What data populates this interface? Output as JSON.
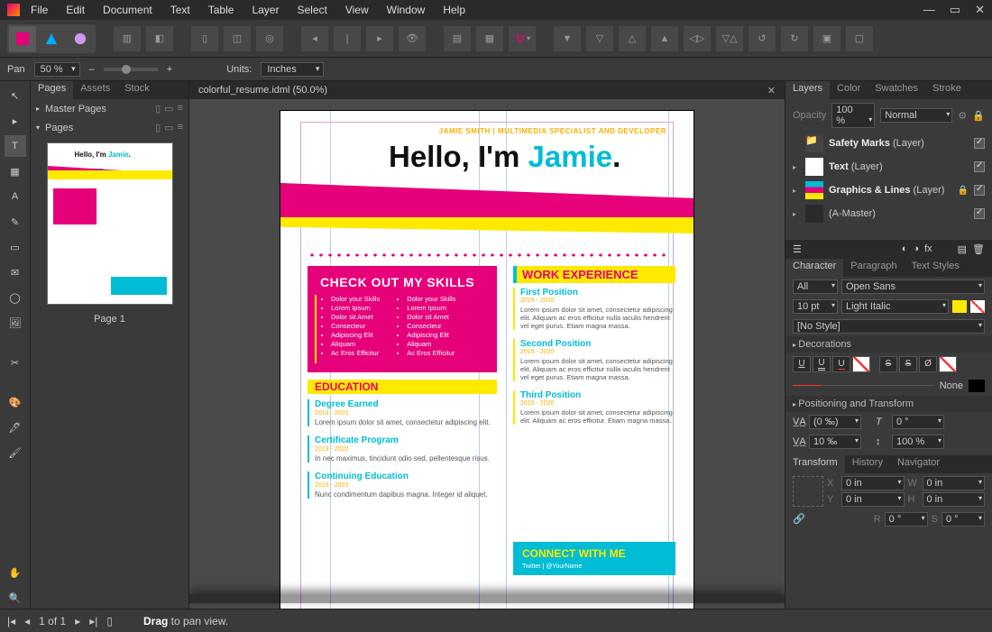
{
  "menu": [
    "File",
    "Edit",
    "Document",
    "Text",
    "Table",
    "Layer",
    "Select",
    "View",
    "Window",
    "Help"
  ],
  "options": {
    "pan_label": "Pan",
    "zoom": "50 %",
    "units_label": "Units:",
    "units": "Inches"
  },
  "pages_panel": {
    "tabs": [
      "Pages",
      "Assets",
      "Stock"
    ],
    "master_label": "Master Pages",
    "pages_label": "Pages",
    "page1_label": "Page 1"
  },
  "doc": {
    "tab_title": "colorful_resume.idml (50.0%)",
    "headline": "JAMIE SMITH | MULTIMEDIA SPECIALIST AND DEVELOPER",
    "hello_pre": "Hello, I'm ",
    "hello_name": "Jamie",
    "hello_dot": ".",
    "skills_title": "CHECK OUT MY SKILLS",
    "skills": [
      "Dolor your Skills",
      "Lorem Ipsum",
      "Dolor sit Amet",
      "Consecteur",
      "Adipiscing Elit",
      "Aliquam",
      "Ac Eros Efficitur"
    ],
    "education_title": "EDUCATION",
    "education": [
      {
        "title": "Degree Earned",
        "dates": "2019 - 2020",
        "body": "Lorem ipsum dolor sit amet, consectetur adipiscing elit."
      },
      {
        "title": "Certificate Program",
        "dates": "2019 - 2020",
        "body": "In nec maximus, tincidunt odio sed, pellentesque risus."
      },
      {
        "title": "Continuing Education",
        "dates": "2019 - 2020",
        "body": "Nunc condimentum dapibus magna. Integer id aliquet."
      }
    ],
    "work_title": "WORK EXPERIENCE",
    "work": [
      {
        "title": "First Position",
        "dates": "2019 - 2020",
        "body": "Lorem ipsum dolor sit amet, consectetur adipiscing elit. Aliquam ac eros efficitur nulla iaculis hendrerit vel eget purus. Etiam magna massa."
      },
      {
        "title": "Second Position",
        "dates": "2019 - 2020",
        "body": "Lorem ipsum dolor sit amet, consectetur adipiscing elit. Aliquam ac eros efficitur nulla iaculis hendrerit vel eget purus. Etiam magna massa."
      },
      {
        "title": "Third Position",
        "dates": "2019 - 2020",
        "body": "Lorem ipsum dolor sit amet, consectetur adipiscing elit. Aliquam ac eros efficitur. Etiam magna massa."
      }
    ],
    "connect_title": "CONNECT WITH ME",
    "connect_body": "Twitter | @YourName"
  },
  "right": {
    "layer_tabs": [
      "Layers",
      "Color",
      "Swatches",
      "Stroke"
    ],
    "opacity_label": "Opacity",
    "opacity_val": "100 %",
    "blend": "Normal",
    "layers": [
      {
        "name": "Safety Marks",
        "type": "(Layer)",
        "folder": true
      },
      {
        "name": "Text",
        "type": "(Layer)"
      },
      {
        "name": "Graphics & Lines",
        "type": "(Layer)",
        "locked": true
      },
      {
        "name": "(A-Master)",
        "type": ""
      }
    ],
    "char_tabs": [
      "Character",
      "Paragraph",
      "Text Styles"
    ],
    "font_filter": "All",
    "font_family": "Open Sans",
    "font_size": "10 pt",
    "font_style": "Light Italic",
    "char_style": "[No Style]",
    "decorations_label": "Decorations",
    "none_label": "None",
    "posxform_label": "Positioning and Transform",
    "kern": "(0 ‰)",
    "kern2": "10 ‰",
    "italic": "0 °",
    "scale": "100 %",
    "bottom_tabs": [
      "Transform",
      "History",
      "Navigator"
    ],
    "xform": {
      "x": "0 in",
      "y": "0 in",
      "w": "0 in",
      "h": "0 in",
      "r": "0 °",
      "s": "0 °"
    }
  },
  "status": {
    "spread": "1 of 1",
    "hint_label": "Drag",
    "hint_rest": " to pan view."
  }
}
